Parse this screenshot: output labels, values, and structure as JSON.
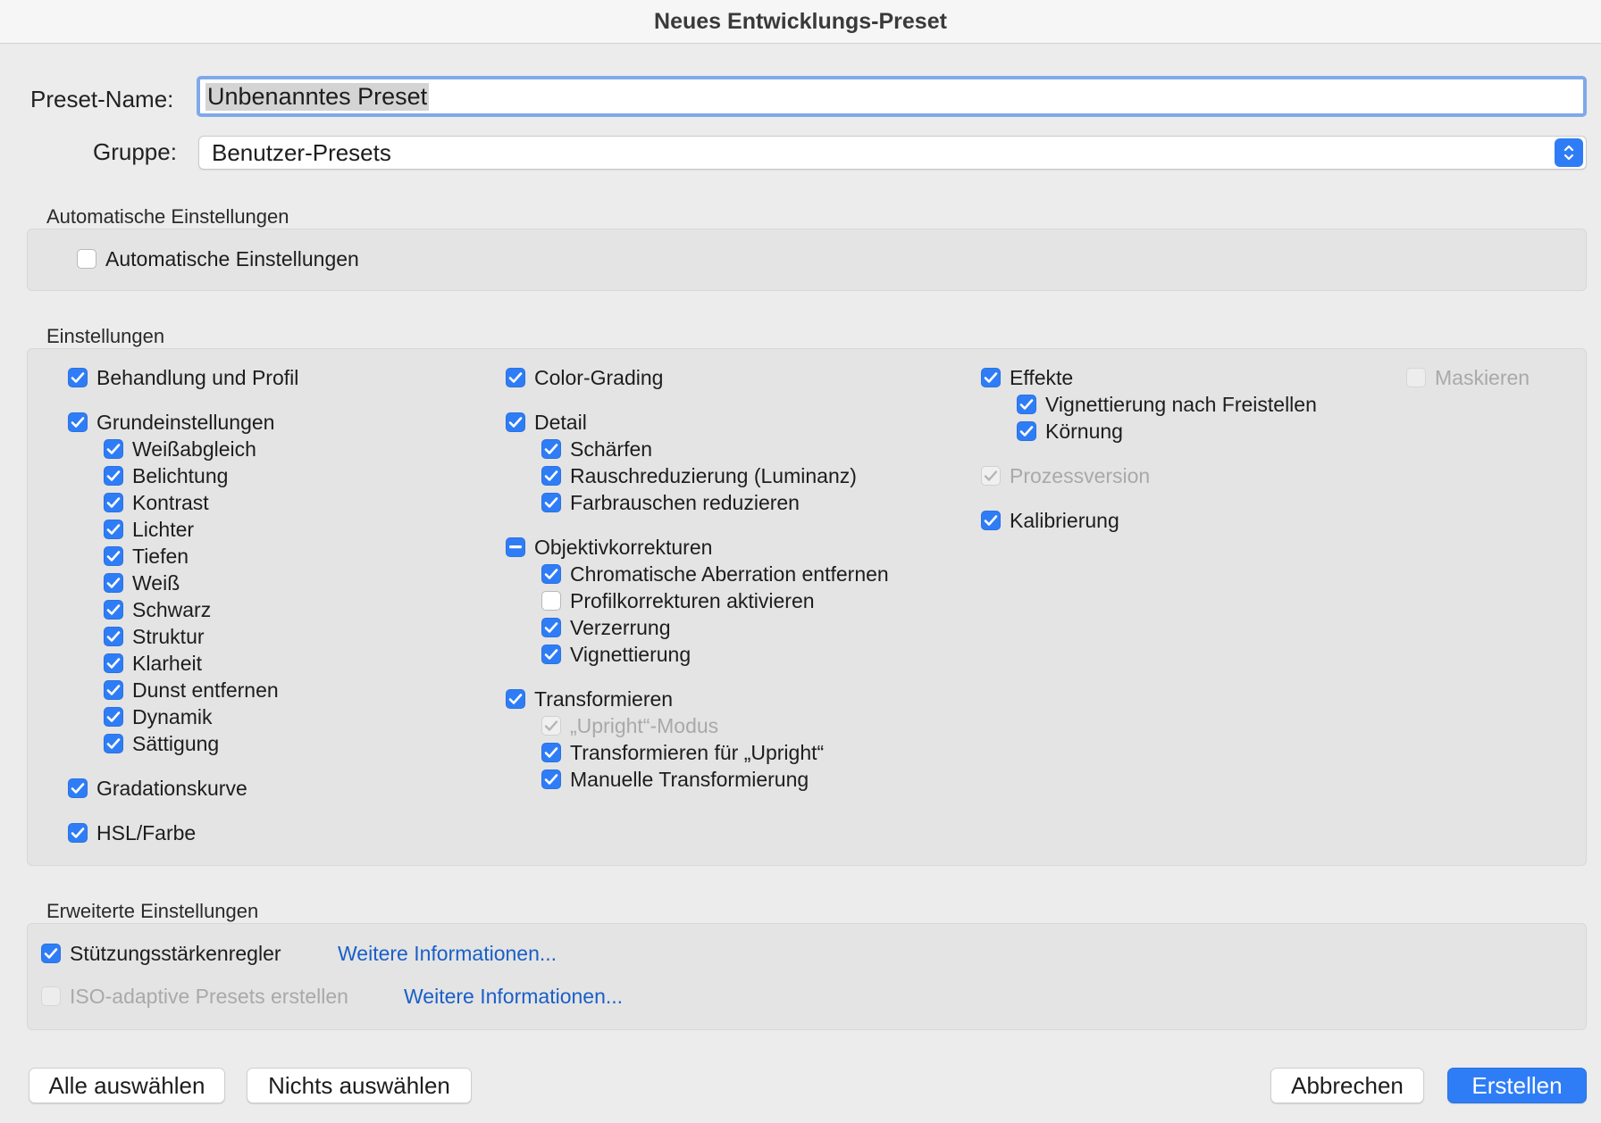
{
  "window": {
    "title": "Neues Entwicklungs-Preset"
  },
  "form": {
    "name_label": "Preset-Name:",
    "name_value": "Unbenanntes Preset",
    "group_label": "Gruppe:",
    "group_value": "Benutzer-Presets"
  },
  "auto": {
    "title": "Automatische Einstellungen",
    "checkbox_label": "Automatische Einstellungen",
    "checked": false
  },
  "settings": {
    "title": "Einstellungen",
    "behandlung": "Behandlung und Profil",
    "grund": "Grundeinstellungen",
    "grund_items": [
      "Weißabgleich",
      "Belichtung",
      "Kontrast",
      "Lichter",
      "Tiefen",
      "Weiß",
      "Schwarz",
      "Struktur",
      "Klarheit",
      "Dunst entfernen",
      "Dynamik",
      "Sättigung"
    ],
    "gradation": "Gradationskurve",
    "hsl": "HSL/Farbe",
    "color_grading": "Color-Grading",
    "detail": "Detail",
    "detail_items": [
      "Schärfen",
      "Rauschreduzierung (Luminanz)",
      "Farbrauschen reduzieren"
    ],
    "objektiv": "Objektivkorrekturen",
    "objektiv_items": [
      "Chromatische Aberration entfernen",
      "Profilkorrekturen aktivieren",
      "Verzerrung",
      "Vignettierung"
    ],
    "transform": "Transformieren",
    "transform_items": [
      "„Upright“-Modus",
      "Transformieren für „Upright“",
      "Manuelle Transformierung"
    ],
    "effekte": "Effekte",
    "effekte_items": [
      "Vignettierung nach Freistellen",
      "Körnung"
    ],
    "prozess": "Prozessversion",
    "kalibrierung": "Kalibrierung",
    "maskieren": "Maskieren"
  },
  "advanced": {
    "title": "Erweiterte Einstellungen",
    "stuetz": "Stützungsstärkenregler",
    "iso": "ISO-adaptive Presets erstellen",
    "link1": "Weitere Informationen...",
    "link2": "Weitere Informationen..."
  },
  "buttons": {
    "select_all": "Alle auswählen",
    "select_none": "Nichts auswählen",
    "cancel": "Abbrechen",
    "create": "Erstellen"
  },
  "colors": {
    "accent": "#2f7df6",
    "link": "#1a5fc8"
  }
}
